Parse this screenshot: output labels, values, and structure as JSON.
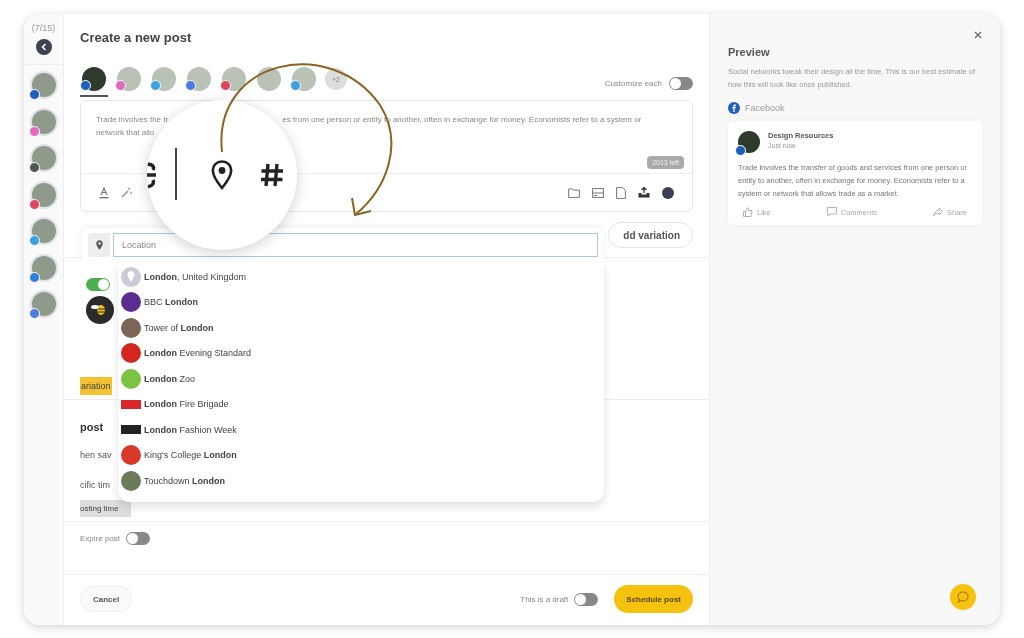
{
  "sidebar": {
    "counter": "(7/15)",
    "accounts": [
      {
        "color": "#1d5fbf"
      },
      {
        "color": "#e36bbf"
      },
      {
        "color": "#555555"
      },
      {
        "color": "#e0465b"
      },
      {
        "color": "#3ea0e6"
      },
      {
        "color": "#2f7fd6"
      },
      {
        "color": "#4a7de0"
      }
    ]
  },
  "composer": {
    "title": "Create a new post",
    "accounts": [
      {
        "color": "#1d5fbf",
        "selected": true
      },
      {
        "color": "#e36bbf",
        "selected": false
      },
      {
        "color": "#3ea0e6",
        "selected": false
      },
      {
        "color": "#4a7de0",
        "selected": false
      },
      {
        "color": "#e0465b",
        "selected": false
      },
      {
        "selected": false
      },
      {
        "color": "#3ea0e6",
        "selected": false
      }
    ],
    "more_accounts": "+2",
    "customize": {
      "label": "Customize each",
      "on": false
    },
    "message": {
      "lines": [
        {
          "before": "Trade involves the tr",
          "after": "es from one person or entity to another, often in exchange for money. Economists refer to a system or"
        },
        {
          "before": "network that allo"
        }
      ],
      "counter": "2013 left"
    },
    "add_variation": "dd variation",
    "location": {
      "placeholder": "Location",
      "suggestions": [
        {
          "kind": "place",
          "text": "**London**, United Kingdom",
          "color": "#c9ccd8"
        },
        {
          "kind": "logo",
          "text": "BBC **London**",
          "color": "#5b2d91"
        },
        {
          "kind": "logo",
          "text": "Tower of **London**",
          "color": "#7a6656"
        },
        {
          "kind": "logo",
          "text": "**London** Evening Standard",
          "color": "#d3261f"
        },
        {
          "kind": "logo",
          "text": "**London** Zoo",
          "color": "#7cc243"
        },
        {
          "kind": "banner",
          "text": "**London** Fire Brigade",
          "color": "#d8262b"
        },
        {
          "kind": "banner",
          "text": "**London** Fashion Week",
          "color": "#222222"
        },
        {
          "kind": "logo",
          "text": "King's College **London**",
          "color": "#d8392b"
        },
        {
          "kind": "logo",
          "text": "Touchdown **London**",
          "color": "#6b7a5a"
        }
      ]
    },
    "behind": {
      "toggle_on": true,
      "variation_tag": "ariation",
      "heading": "post",
      "line_1": "hen sav",
      "line_2": "cific tim",
      "time_tag": "osting time"
    },
    "expire": {
      "label": "Expire post",
      "on": false
    },
    "footer": {
      "cancel": "Cancel",
      "draft": {
        "label": "This is a draft",
        "on": false
      },
      "schedule": "Schedule post"
    }
  },
  "preview": {
    "title": "Preview",
    "description": "Social networks tweak their design all the time. This is our best estimate of how this will look like once published.",
    "network": "Facebook",
    "post": {
      "author": "Design Resources",
      "time": "Just now",
      "text": "Trade involves the transfer of goods and services from one person or entity to another, often in exchange for money. Economists refer to a system or network that allows trade as a market.",
      "actions": [
        "Like",
        "Comments",
        "Share"
      ]
    }
  }
}
